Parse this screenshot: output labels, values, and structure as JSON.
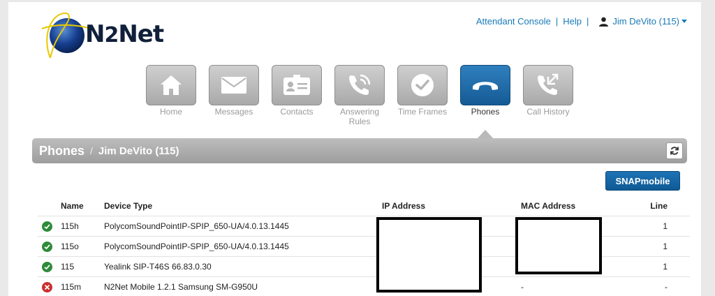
{
  "brand": {
    "name_prefix": "N",
    "name_two": "2",
    "name_suffix": "Net"
  },
  "toplinks": {
    "attendant": "Attendant Console",
    "sep1": "|",
    "help": "Help",
    "sep2": "|",
    "user": "Jim DeVito (115)"
  },
  "nav": [
    {
      "label": "Home",
      "icon": "home-icon",
      "active": false
    },
    {
      "label": "Messages",
      "icon": "envelope-icon",
      "active": false
    },
    {
      "label": "Contacts",
      "icon": "contact-card-icon",
      "active": false
    },
    {
      "label": "Answering Rules",
      "icon": "phone-rules-icon",
      "active": false
    },
    {
      "label": "Time Frames",
      "icon": "clock-icon",
      "active": false
    },
    {
      "label": "Phones",
      "icon": "phone-handset-icon",
      "active": true
    },
    {
      "label": "Call History",
      "icon": "call-history-icon",
      "active": false
    }
  ],
  "header": {
    "title": "Phones",
    "sep": "/",
    "subtitle": "Jim DeVito (115)"
  },
  "snap_button": "SNAPmobile",
  "table": {
    "columns": [
      "Name",
      "Device Type",
      "IP Address",
      "MAC Address",
      "Line"
    ],
    "rows": [
      {
        "status": "ok",
        "name": "115h",
        "type": "PolycomSoundPointIP-SPIP_650-UA/4.0.13.1445",
        "ip": "",
        "mac": "",
        "line": "1"
      },
      {
        "status": "ok",
        "name": "115o",
        "type": "PolycomSoundPointIP-SPIP_650-UA/4.0.13.1445",
        "ip": "",
        "mac": "",
        "line": "1"
      },
      {
        "status": "ok",
        "name": "115",
        "type": "Yealink SIP-T46S 66.83.0.30",
        "ip": "",
        "mac": "",
        "line": "1"
      },
      {
        "status": "error",
        "name": "115m",
        "type": "N2Net Mobile 1.2.1 Samsung SM-G950U",
        "ip": "",
        "mac": "-",
        "line": "-"
      }
    ]
  },
  "colors": {
    "accent": "#1a7ab8",
    "active_nav": "#1f6aa8",
    "ok": "#2e8a3a",
    "error": "#c9302c"
  }
}
